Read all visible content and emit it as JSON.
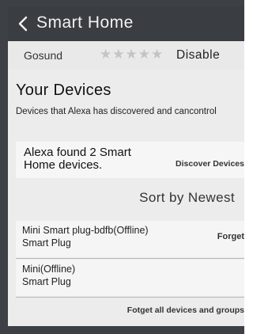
{
  "header": {
    "title": "Smart Home",
    "back_icon": "chevron-left-icon"
  },
  "skill": {
    "name": "Gosund",
    "rating_stars": "★★★★★",
    "rating_filled": 0,
    "action_label": "Disable"
  },
  "devices_section": {
    "title": "Your Devices",
    "subtitle": "Devices that Alexa has discovered and cancontrol",
    "found_message": "Alexa found 2 Smart Home devices.",
    "discover_label": "Discover Devices",
    "sort_label": "Sort by Newest",
    "forget_all_label": "Fotget all devices and groups"
  },
  "devices": [
    {
      "name": "Mini Smart plug-bdfb(Offline)",
      "type": "Smart Plug",
      "action_label": "Forget"
    },
    {
      "name": "Mini(Offline)",
      "type": "Smart Plug",
      "action_label": ""
    }
  ],
  "colors": {
    "header_bg": "#3a3d41",
    "page_bg": "#ececec",
    "star_empty": "#c4c4c4"
  }
}
